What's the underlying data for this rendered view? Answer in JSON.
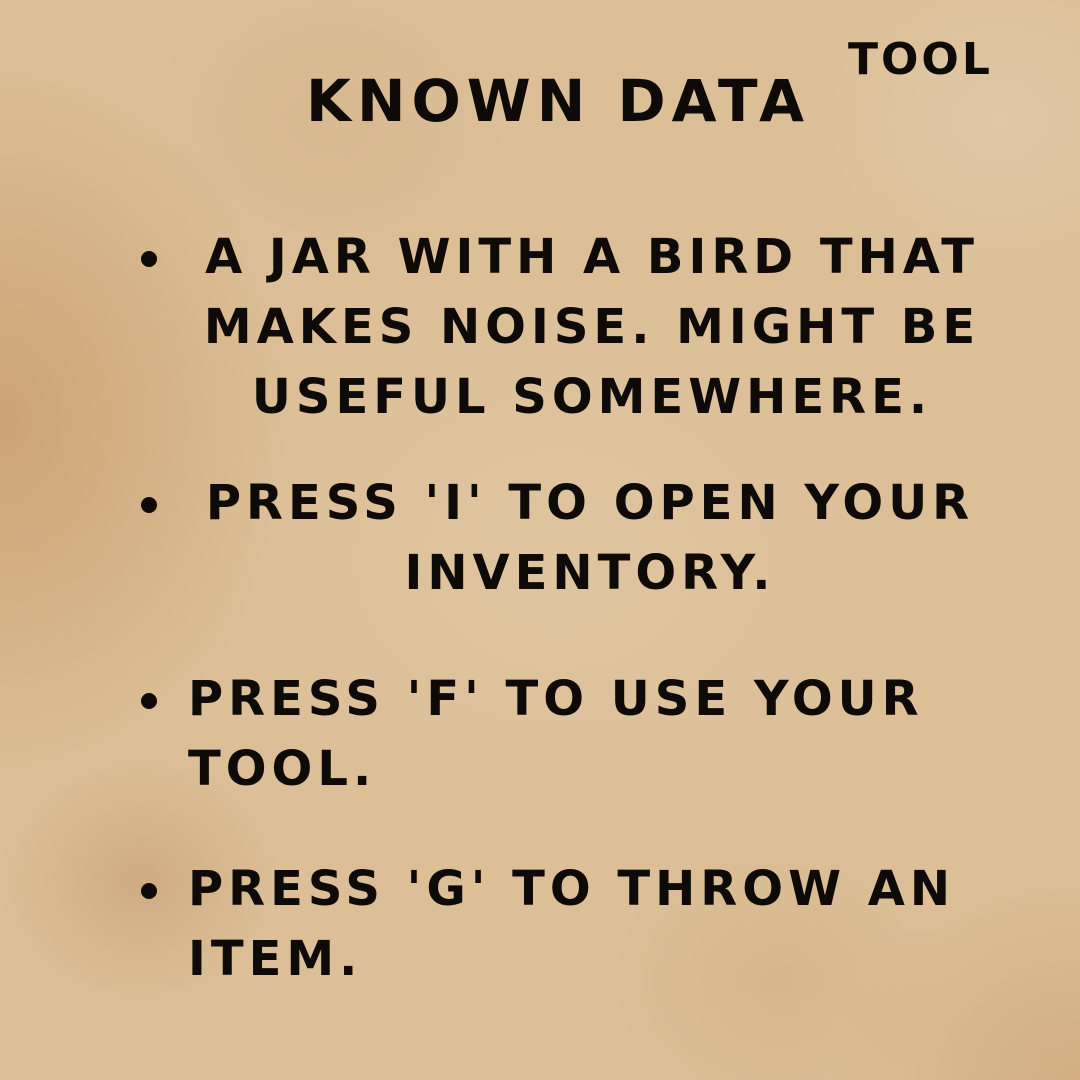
{
  "header": {
    "title": "KNOWN DATA",
    "tool_label": "TOOL"
  },
  "items": [
    {
      "text": "A JAR WITH A BIRD THAT\nMAKES NOISE. MIGHT BE\nUSEFUL SOMEWHERE."
    },
    {
      "text": "PRESS 'I' TO OPEN YOUR\nINVENTORY."
    },
    {
      "text": "PRESS 'F' TO USE YOUR\nTOOL."
    },
    {
      "text": " PRESS 'G' TO THROW AN\nITEM."
    }
  ],
  "colors": {
    "paper": "#dcbf97",
    "ink": "#0d0a07"
  }
}
